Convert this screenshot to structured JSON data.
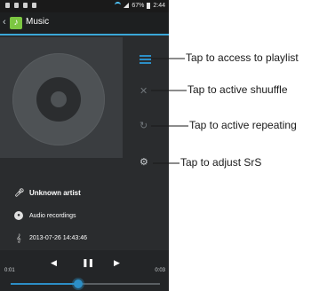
{
  "status_bar": {
    "battery_percent": "67%",
    "time": "2:44"
  },
  "action_bar": {
    "title": "Music"
  },
  "track": {
    "artist": "Unknown artist",
    "album": "Audio recordings",
    "date": "2013-07-26 14:43:46"
  },
  "player": {
    "elapsed": "0:01",
    "duration": "0:03",
    "progress_fraction": 0.45
  },
  "annotations": {
    "playlist": "Tap to access to playlist",
    "shuffle": "Tap to active shuuffle",
    "repeat": "Tap to active repeating",
    "srs": "Tap to adjust SrS"
  },
  "colors": {
    "accent": "#2c8ec6",
    "app_icon": "#7cc642",
    "annotation_line": "#1a1a1a"
  }
}
